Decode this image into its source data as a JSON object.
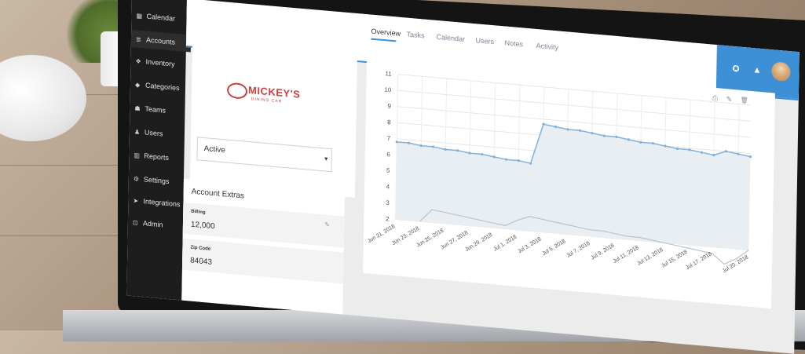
{
  "nav": {
    "items": [
      {
        "label": "Calendar",
        "icon": "calendar-icon",
        "glyph": "▦"
      },
      {
        "label": "Accounts",
        "icon": "accounts-icon",
        "glyph": "≣",
        "active": true
      },
      {
        "label": "Inventory",
        "icon": "inventory-icon",
        "glyph": "❖"
      },
      {
        "label": "Categories",
        "icon": "tag-icon",
        "glyph": "◆"
      },
      {
        "label": "Teams",
        "icon": "teams-icon",
        "glyph": "☗"
      },
      {
        "label": "Users",
        "icon": "user-icon",
        "glyph": "♟"
      },
      {
        "label": "Reports",
        "icon": "reports-icon",
        "glyph": "▥"
      },
      {
        "label": "Settings",
        "icon": "settings-icon",
        "glyph": "⚙"
      },
      {
        "label": "Integrations",
        "icon": "integrations-icon",
        "glyph": "➤"
      },
      {
        "label": "Admin",
        "icon": "lock-icon",
        "glyph": "⊡"
      }
    ]
  },
  "tabs": [
    {
      "label": "Overview",
      "active": true
    },
    {
      "label": "Tasks"
    },
    {
      "label": "Calendar"
    },
    {
      "label": "Users"
    },
    {
      "label": "Notes"
    },
    {
      "label": "Activity"
    }
  ],
  "header_icons": {
    "support": "✪",
    "notifications": "▲"
  },
  "account": {
    "logo_name": "MICKEY'S",
    "logo_sub": "DINING CAR",
    "status_value": "Active",
    "extras_title": "Account Extras",
    "fields": [
      {
        "label": "Billing",
        "value": "12,000"
      },
      {
        "label": "Zip Code",
        "value": "84043"
      }
    ]
  },
  "chart_tools": {
    "print": "⎙",
    "edit": "✎",
    "delete": "🗑"
  },
  "colors": {
    "accent": "#3d8fd6",
    "brand": "#c9403c",
    "sidebar": "#1d1d1d",
    "area": "#e9eef3",
    "line": "#7fb2dd"
  },
  "chart_data": {
    "type": "line",
    "x": [
      "Jun 21, 2018",
      "Jun 22, 2018",
      "Jun 23, 2018",
      "Jun 24, 2018",
      "Jun 25, 2018",
      "Jun 26, 2018",
      "Jun 27, 2018",
      "Jun 28, 2018",
      "Jun 29, 2018",
      "Jun 30, 2018",
      "Jul 1, 2018",
      "Jul 2, 2018",
      "Jul 3, 2018",
      "Jul 4, 2018",
      "Jul 5, 2018",
      "Jul 6, 2018",
      "Jul 7, 2018",
      "Jul 8, 2018",
      "Jul 9, 2018",
      "Jul 10, 2018",
      "Jul 11, 2018",
      "Jul 12, 2018",
      "Jul 13, 2018",
      "Jul 14, 2018",
      "Jul 15, 2018",
      "Jul 16, 2018",
      "Jul 17, 2018",
      "Jul 18, 2018",
      "Jul 19, 2018",
      "Jul 20, 2018"
    ],
    "x_tick_labels": [
      "Jun 21, 2018",
      "Jun 23, 2018",
      "Jun 25, 2018",
      "Jun 27, 2018",
      "Jun 29, 2018",
      "Jul 1, 2018",
      "Jul 3, 2018",
      "Jul 5, 2018",
      "Jul 7, 2018",
      "Jul 9, 2018",
      "Jul 11, 2018",
      "Jul 13, 2018",
      "Jul 15, 2018",
      "Jul 17, 2018",
      "Jul 20, 2018"
    ],
    "series": [
      {
        "values": [
          6.8,
          6.8,
          6.7,
          6.7,
          6.6,
          6.6,
          6.5,
          6.5,
          6.4,
          6.3,
          6.3,
          6.2,
          8.7,
          8.6,
          8.5,
          8.5,
          8.4,
          8.3,
          8.3,
          8.2,
          8.1,
          8.1,
          8.0,
          7.9,
          7.9,
          7.8,
          7.7,
          8.0,
          7.9,
          7.8
        ]
      },
      {
        "values": [
          null,
          null,
          2.0,
          2.8,
          2.7,
          2.6,
          2.5,
          2.4,
          2.3,
          2.2,
          2.6,
          2.9,
          2.8,
          2.7,
          2.6,
          2.5,
          2.4,
          2.4,
          2.3,
          2.2,
          2.2,
          2.1,
          2.0,
          1.9,
          1.8,
          1.7,
          1.6,
          0.8,
          1.4,
          2.0
        ]
      }
    ],
    "ylim": [
      2,
      11
    ],
    "yticks": [
      2,
      3,
      4,
      5,
      6,
      7,
      8,
      9,
      10,
      11
    ],
    "grid": true
  }
}
